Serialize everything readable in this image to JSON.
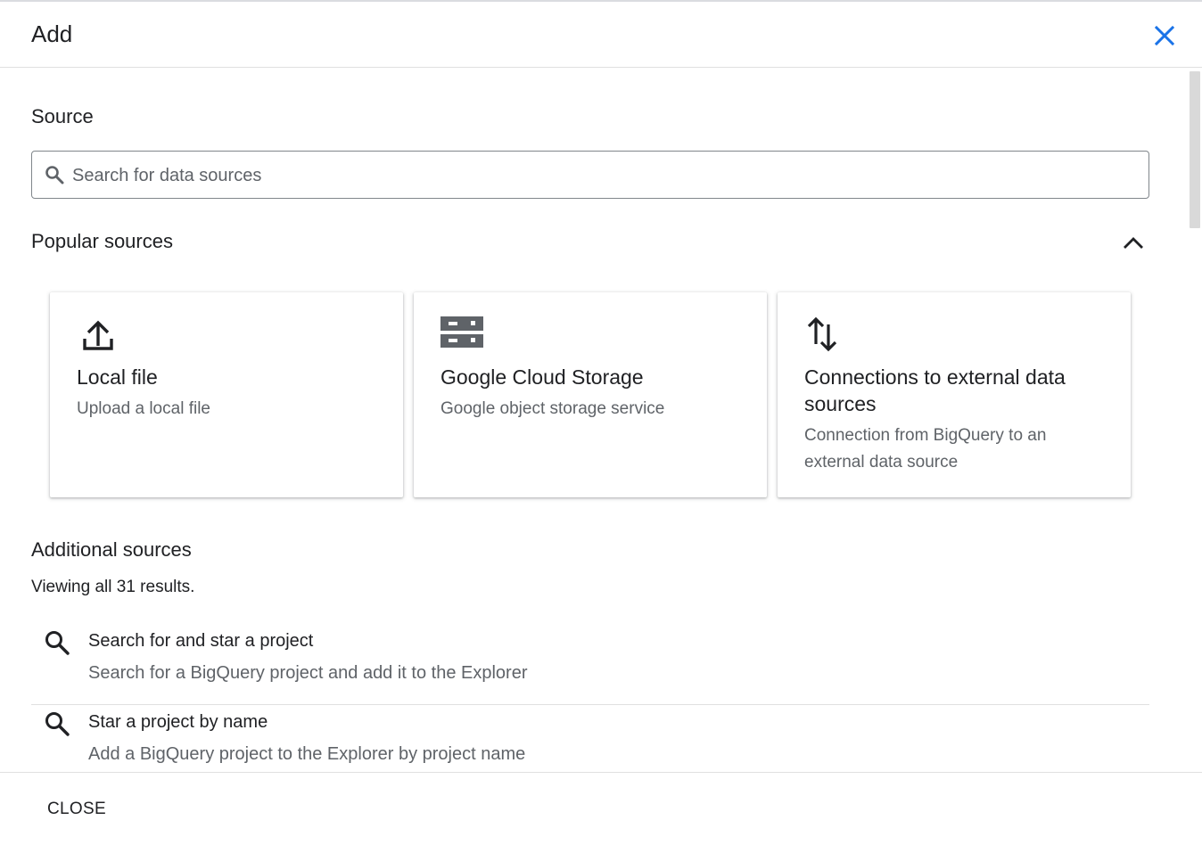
{
  "header": {
    "title": "Add",
    "close_icon": "close-icon",
    "accent_color": "#1a73e8"
  },
  "source": {
    "title": "Source",
    "search": {
      "placeholder": "Search for data sources",
      "value": "",
      "icon": "search-icon"
    }
  },
  "popular": {
    "title": "Popular sources",
    "toggle_icon": "chevron-up-icon",
    "cards": [
      {
        "icon": "upload-icon",
        "title": "Local file",
        "description": "Upload a local file"
      },
      {
        "icon": "storage-icon",
        "title": "Google Cloud Storage",
        "description": "Google object storage service"
      },
      {
        "icon": "swap-vertical-icon",
        "title": "Connections to external data sources",
        "description": "Connection from BigQuery to an external data source"
      }
    ]
  },
  "additional": {
    "title": "Additional sources",
    "results_text": "Viewing all 31 results.",
    "items": [
      {
        "icon": "search-icon",
        "title": "Search for and star a project",
        "description": "Search for a BigQuery project and add it to the Explorer"
      },
      {
        "icon": "search-icon",
        "title": "Star a project by name",
        "description": "Add a BigQuery project to the Explorer by project name"
      }
    ]
  },
  "footer": {
    "close_label": "CLOSE"
  }
}
